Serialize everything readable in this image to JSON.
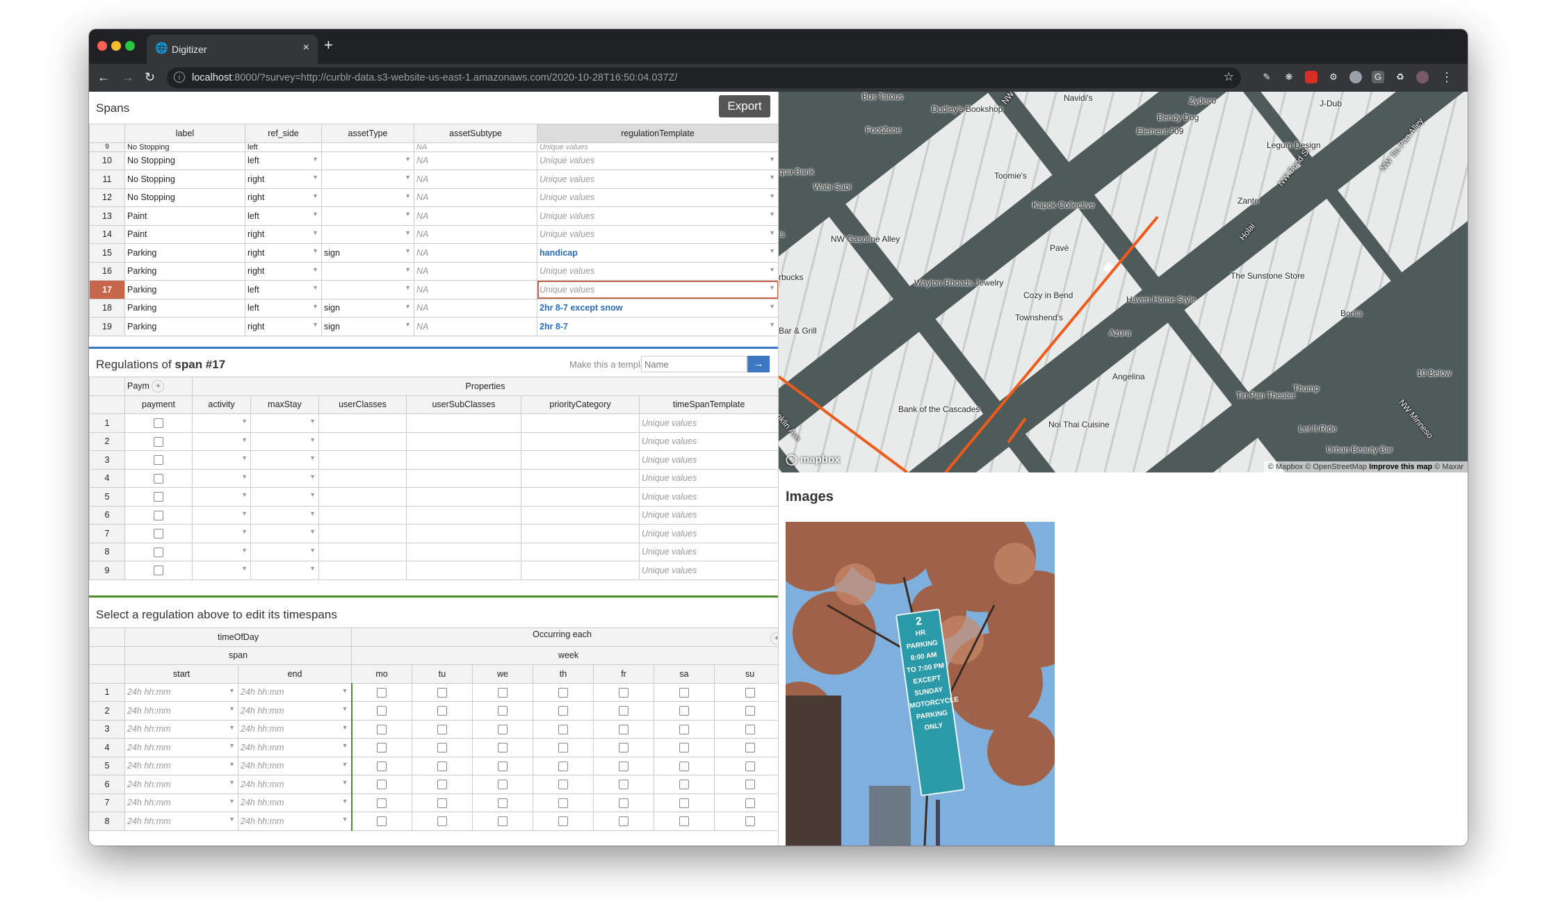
{
  "browser": {
    "tab_title": "Digitizer",
    "tab_close": "×",
    "new_tab": "+",
    "url_host": "localhost",
    "url_rest": ":8000/?survey=http://curblr-data.s3-website-us-east-1.amazonaws.com/2020-10-28T16:50:04.037Z/",
    "back": "←",
    "forward": "→",
    "reload": "↻",
    "info": "i",
    "star": "☆",
    "menu": "⋮"
  },
  "spans": {
    "title": "Spans",
    "export_label": "Export",
    "columns": [
      "label",
      "ref_side",
      "assetType",
      "assetSubtype",
      "regulationTemplate"
    ],
    "partial_row": {
      "label": "No Stopping",
      "ref_side": "left",
      "assetSubtype": "NA",
      "regulationTemplate": "Unique values"
    },
    "rows": [
      {
        "n": "10",
        "label": "No Stopping",
        "ref_side": "left",
        "assetType": "",
        "assetSubtype": "NA",
        "regulationTemplate": "Unique values"
      },
      {
        "n": "11",
        "label": "No Stopping",
        "ref_side": "right",
        "assetType": "",
        "assetSubtype": "NA",
        "regulationTemplate": "Unique values"
      },
      {
        "n": "12",
        "label": "No Stopping",
        "ref_side": "right",
        "assetType": "",
        "assetSubtype": "NA",
        "regulationTemplate": "Unique values"
      },
      {
        "n": "13",
        "label": "Paint",
        "ref_side": "left",
        "assetType": "",
        "assetSubtype": "NA",
        "regulationTemplate": "Unique values"
      },
      {
        "n": "14",
        "label": "Paint",
        "ref_side": "right",
        "assetType": "",
        "assetSubtype": "NA",
        "regulationTemplate": "Unique values"
      },
      {
        "n": "15",
        "label": "Parking",
        "ref_side": "right",
        "assetType": "sign",
        "assetSubtype": "NA",
        "regulationTemplate": "handicap"
      },
      {
        "n": "16",
        "label": "Parking",
        "ref_side": "right",
        "assetType": "",
        "assetSubtype": "NA",
        "regulationTemplate": "Unique values"
      },
      {
        "n": "17",
        "label": "Parking",
        "ref_side": "left",
        "assetType": "",
        "assetSubtype": "NA",
        "regulationTemplate": "Unique values"
      },
      {
        "n": "18",
        "label": "Parking",
        "ref_side": "left",
        "assetType": "sign",
        "assetSubtype": "NA",
        "regulationTemplate": "2hr 8-7 except snow"
      },
      {
        "n": "19",
        "label": "Parking",
        "ref_side": "right",
        "assetType": "sign",
        "assetSubtype": "NA",
        "regulationTemplate": "2hr 8-7"
      }
    ]
  },
  "regulations": {
    "title_prefix": "Regulations of ",
    "title_span": "span #17",
    "template_prompt": "Make this a template",
    "template_placeholder": "Name",
    "template_button": "→",
    "group_payment": "Paym",
    "group_properties": "Properties",
    "add": "+",
    "columns": [
      "payment",
      "activity",
      "maxStay",
      "userClasses",
      "userSubClasses",
      "priorityCategory",
      "timeSpanTemplate"
    ],
    "rows": [
      "1",
      "2",
      "3",
      "4",
      "5",
      "6",
      "7",
      "8",
      "9"
    ],
    "time_span_value": "Unique values"
  },
  "timespans": {
    "title": "Select a regulation above to edit its timespans",
    "group_time_of_day": "timeOfDay",
    "group_occurring": "Occurring each",
    "add": "+",
    "sub_span": "span",
    "sub_week": "week",
    "columns": [
      "start",
      "end",
      "mo",
      "tu",
      "we",
      "th",
      "fr",
      "sa",
      "su"
    ],
    "time_placeholder": "24h hh:mm",
    "rows": [
      "1",
      "2",
      "3",
      "4",
      "5",
      "6",
      "7",
      "8"
    ]
  },
  "map": {
    "logo": "mapbox",
    "attribution": "© Mapbox © OpenStreetMap",
    "improve": "Improve this map",
    "maxar": "© Maxar",
    "labels": [
      {
        "text": "Bus Tatous"
      },
      {
        "text": "Dudley's Bookshop"
      },
      {
        "text": "NW Minnesota Ave"
      },
      {
        "text": "Navidi's"
      },
      {
        "text": "Zydeco"
      },
      {
        "text": "J-Dub"
      },
      {
        "text": "Bendy Dog"
      },
      {
        "text": "FootZone"
      },
      {
        "text": "Element 909"
      },
      {
        "text": "Legum Design"
      },
      {
        "text": "qua Bank"
      },
      {
        "text": "Wabi Sabi"
      },
      {
        "text": "Toomie's"
      },
      {
        "text": "NW Bond St"
      },
      {
        "text": "Zante"
      },
      {
        "text": "NW Tin Pan Alley"
      },
      {
        "text": "Kapok Collective"
      },
      {
        "text": "Holai"
      },
      {
        "text": "Pavé"
      },
      {
        "text": "NW Gasoline Alley"
      },
      {
        "text": "The Sunstone Store"
      },
      {
        "text": "Waylon Rhoads Jewelry"
      },
      {
        "text": "Cozy in Bend"
      },
      {
        "text": "Haven Home Style"
      },
      {
        "text": "Bonta"
      },
      {
        "text": "Townshend's"
      },
      {
        "text": "Azura"
      },
      {
        "text": "Bar & Grill"
      },
      {
        "text": "Angelina"
      },
      {
        "text": "10 Below"
      },
      {
        "text": "Bank of the Cascades"
      },
      {
        "text": "Tin Pan Theater"
      },
      {
        "text": "Thump"
      },
      {
        "text": "Noi Thai Cuisine"
      },
      {
        "text": "Let It Ride"
      },
      {
        "text": "Urban Beauty Bar"
      },
      {
        "text": "anklin Ave"
      },
      {
        "text": "rbucks"
      },
      {
        "text": "is"
      },
      {
        "text": "NW Minneso"
      }
    ]
  },
  "images": {
    "title": "Images",
    "sign_lines": [
      "2",
      "HR PARKING",
      "8:00 AM",
      "TO 7:00 PM",
      "EXCEPT SUNDAY",
      "MOTORCYCLE",
      "PARKING",
      "ONLY"
    ]
  },
  "colors": {
    "accent": "#3c78c2",
    "selected_row": "#c8664b",
    "template_link": "#2a6db8",
    "route": "#f05a1a"
  }
}
